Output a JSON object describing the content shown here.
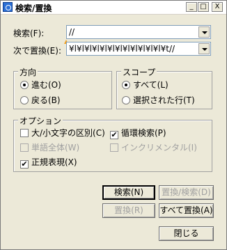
{
  "window": {
    "title": "検索/置換",
    "minimize_label": "_",
    "maximize_label": "□",
    "close_label": "X"
  },
  "find": {
    "label": "検索(F):",
    "value": "//"
  },
  "replace": {
    "label": "次で置換(E):",
    "value": "¥l¥l¥l¥l¥l¥l¥l¥l¥l¥l¥l¥l¥t//"
  },
  "direction": {
    "legend": "方向",
    "options": [
      {
        "label": "進む(O)",
        "selected": true
      },
      {
        "label": "戻る(B)",
        "selected": false
      }
    ]
  },
  "scope": {
    "legend": "スコープ",
    "options": [
      {
        "label": "すべて(L)",
        "selected": true
      },
      {
        "label": "選択された行(T)",
        "selected": false
      }
    ]
  },
  "options": {
    "legend": "オプション",
    "case_sensitive": {
      "label": "大/小文字の区別(C)",
      "checked": false
    },
    "wrap_search": {
      "label": "循環検索(P)",
      "checked": true
    },
    "whole_word": {
      "label": "単語全体(W)",
      "checked": false,
      "disabled": true
    },
    "incremental": {
      "label": "インクリメンタル(I)",
      "checked": false,
      "disabled": true
    },
    "regex": {
      "label": "正規表現(X)",
      "checked": true
    },
    "check_mark": "✔"
  },
  "buttons": {
    "find": "検索(N)",
    "replace_find": "置換/検索(D)",
    "replace": "置換(R)",
    "replace_all": "すべて置換(A)",
    "close": "閉じる"
  }
}
